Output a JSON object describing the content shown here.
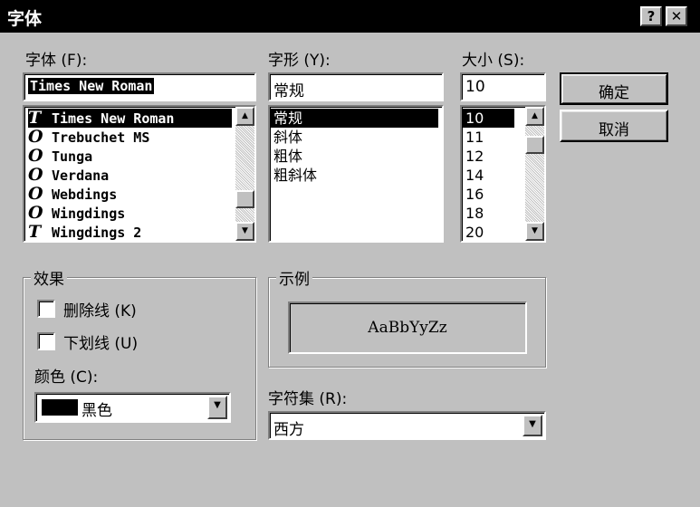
{
  "window": {
    "title": "字体",
    "help_button": "?",
    "close_button": "✕"
  },
  "font": {
    "label": "字体",
    "shortcut": "(F):",
    "value": "Times New Roman",
    "items": [
      {
        "name": "Times New Roman",
        "icon": "truetype-icon",
        "selected": true
      },
      {
        "name": "Trebuchet MS",
        "icon": "opentype-icon"
      },
      {
        "name": "Tunga",
        "icon": "opentype-icon"
      },
      {
        "name": "Verdana",
        "icon": "opentype-icon"
      },
      {
        "name": "Webdings",
        "icon": "opentype-icon"
      },
      {
        "name": "Wingdings",
        "icon": "opentype-icon"
      },
      {
        "name": "Wingdings 2",
        "icon": "truetype-icon"
      }
    ]
  },
  "style": {
    "label": "字形",
    "shortcut": "(Y):",
    "value": "常规",
    "items": [
      "常规",
      "斜体",
      "粗体",
      "粗斜体"
    ]
  },
  "size": {
    "label": "大小",
    "shortcut": "(S):",
    "value": "10",
    "items": [
      "10",
      "11",
      "12",
      "14",
      "16",
      "18",
      "20"
    ]
  },
  "buttons": {
    "ok": "确定",
    "cancel": "取消"
  },
  "effects": {
    "title": "效果",
    "strikeout": "删除线",
    "strikeout_key": "(K)",
    "underline": "下划线",
    "underline_key": "(U)",
    "color_label": "颜色",
    "color_key": "(C):",
    "color_value": "黑色",
    "color_swatch": "#000000"
  },
  "sample": {
    "title": "示例",
    "text": "AaBbYyZz"
  },
  "script": {
    "label": "字符集",
    "shortcut": "(R):",
    "value": "西方"
  }
}
